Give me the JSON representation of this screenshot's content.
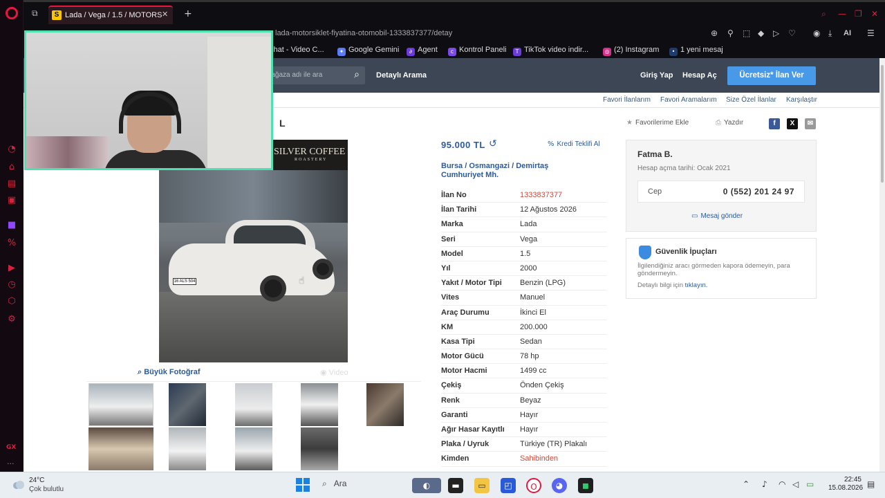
{
  "browser": {
    "tab_title": "Lada / Vega / 1.5 / MOTORS",
    "tab_favicon": "S",
    "url": "lada-motorsiklet-fiyatina-otomobil-1333837377/detay",
    "ai_label": "AI",
    "bookmarks": [
      {
        "label": "chat - Video C...",
        "icon": "chat-icon"
      },
      {
        "label": "Google Gemini",
        "icon": "gemini-icon"
      },
      {
        "label": "Agent",
        "icon": "agent-icon"
      },
      {
        "label": "Kontrol Paneli",
        "icon": "panel-icon"
      },
      {
        "label": "TikTok video indir...",
        "icon": "tiktok-icon"
      },
      {
        "label": "(2) Instagram",
        "icon": "instagram-icon"
      },
      {
        "label": "1 yeni mesaj",
        "icon": "message-icon"
      }
    ]
  },
  "header": {
    "search_placeholder": "mağaza adı ile ara",
    "detailed_search": "Detaylı Arama",
    "login": "Giriş Yap",
    "register": "Hesap Aç",
    "post_ad": "Ücretsiz* İlan Ver"
  },
  "subnav": [
    "Favori İlanlarım",
    "Favori Aramalarım",
    "Size Özel İlanlar",
    "Karşılaştır"
  ],
  "listing": {
    "title_fragment": "B L",
    "add_favorite": "Favorilerime Ekle",
    "print": "Yazdır",
    "photo_tab_large": "Büyük Fotoğraf",
    "photo_tab_video": "Video",
    "store_sign": "SILVER COFFEE",
    "store_sign_sub": "ROASTERY",
    "plate_text": "16 ALS 504",
    "price": "95.000 TL",
    "credit_offer": "Kredi Teklifi Al",
    "location": "Bursa  /  Osmangazi  /  Demirtaş Cumhuriyet Mh.",
    "specs": [
      {
        "k": "İlan No",
        "v": "1333837377",
        "red": true
      },
      {
        "k": "İlan Tarihi",
        "v": "12 Ağustos 2026"
      },
      {
        "k": "Marka",
        "v": "Lada"
      },
      {
        "k": "Seri",
        "v": "Vega"
      },
      {
        "k": "Model",
        "v": "1.5"
      },
      {
        "k": "Yıl",
        "v": "2000"
      },
      {
        "k": "Yakıt / Motor Tipi",
        "v": "Benzin (LPG)"
      },
      {
        "k": "Vites",
        "v": "Manuel"
      },
      {
        "k": "Araç Durumu",
        "v": "İkinci El"
      },
      {
        "k": "KM",
        "v": "200.000"
      },
      {
        "k": "Kasa Tipi",
        "v": "Sedan"
      },
      {
        "k": "Motor Gücü",
        "v": "78 hp"
      },
      {
        "k": "Motor Hacmi",
        "v": "1499 cc"
      },
      {
        "k": "Çekiş",
        "v": "Önden Çekiş"
      },
      {
        "k": "Renk",
        "v": "Beyaz"
      },
      {
        "k": "Garanti",
        "v": "Hayır"
      },
      {
        "k": "Ağır Hasar Kayıtlı",
        "v": "Hayır"
      },
      {
        "k": "Plaka / Uyruk",
        "v": "Türkiye (TR) Plakalı"
      },
      {
        "k": "Kimden",
        "v": "Sahibinden",
        "red": true
      }
    ]
  },
  "seller": {
    "name": "Fatma B.",
    "since": "Hesap açma tarihi: Ocak 2021",
    "phone_label": "Cep",
    "phone": "0 (552) 201 24 97",
    "send_message": "Mesaj gönder"
  },
  "safety": {
    "title": "Güvenlik İpuçları",
    "text": "İlgilendiğiniz aracı görmeden kapora ödemeyin, para göndermeyin.",
    "link_prefix": "Detaylı bilgi için",
    "link": "tıklayın."
  },
  "taskbar": {
    "temp": "24°C",
    "weather": "Çok bulutlu",
    "search": "Ara",
    "time": "22:45",
    "date": "15.08.2026"
  },
  "colors": {
    "header_bg": "#3c4654",
    "accent_blue": "#489ae9",
    "link_blue": "#2a5aa0",
    "opera_red": "#e8173d",
    "webcam_border": "#4fe0b0"
  }
}
